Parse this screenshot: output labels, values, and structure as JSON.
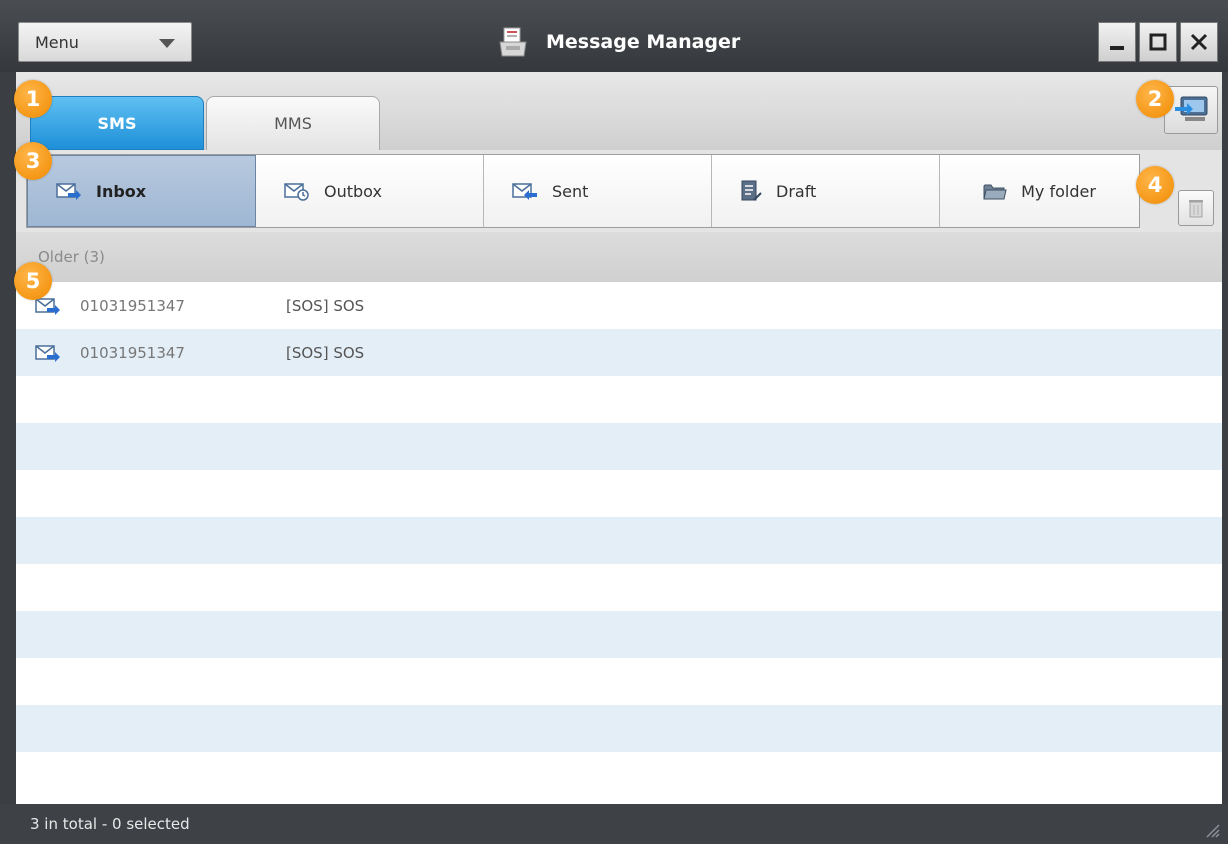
{
  "window": {
    "menu_label": "Menu",
    "title": "Message Manager"
  },
  "tabs": [
    {
      "label": "SMS",
      "active": true
    },
    {
      "label": "MMS",
      "active": false
    }
  ],
  "folders": [
    {
      "label": "Inbox",
      "icon": "inbox-icon",
      "active": true
    },
    {
      "label": "Outbox",
      "icon": "outbox-icon",
      "active": false
    },
    {
      "label": "Sent",
      "icon": "sent-icon",
      "active": false
    },
    {
      "label": "Draft",
      "icon": "draft-icon",
      "active": false
    },
    {
      "label": "My folder",
      "icon": "folder-icon",
      "active": false
    }
  ],
  "list": {
    "group_label": "Older (3)",
    "rows": [
      {
        "number": "01031951347",
        "message": "[SOS]  SOS"
      },
      {
        "number": "01031951347",
        "message": "[SOS]  SOS"
      }
    ]
  },
  "status": {
    "text": "3 in total - 0 selected"
  },
  "callouts": [
    "1",
    "2",
    "3",
    "4",
    "5"
  ],
  "colors": {
    "accent": "#1e8fd8",
    "callout": "#f39200",
    "selected_folder": "#a9bfd8",
    "row_stripe": "#e3eef7"
  }
}
